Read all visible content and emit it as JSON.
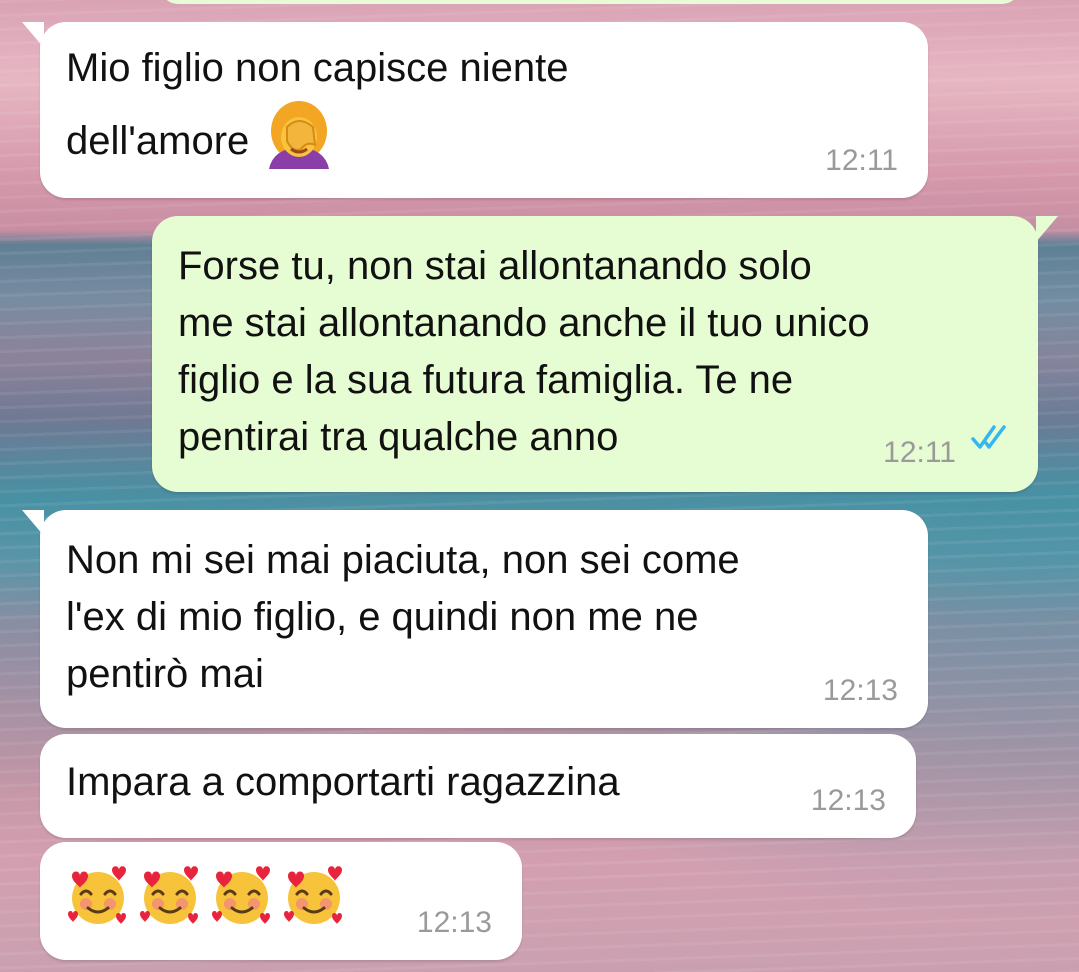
{
  "messages": [
    {
      "direction": "incoming",
      "lines": [
        "Mio figlio non capisce niente",
        "dell'amore"
      ],
      "emoji": "woman-facepalming",
      "time": "12:11"
    },
    {
      "direction": "outgoing",
      "lines": [
        "Forse tu, non stai allontanando solo",
        "me stai allontanando anche il tuo unico",
        "figlio e la sua futura famiglia. Te ne",
        "pentirai tra qualche anno"
      ],
      "time": "12:11",
      "status_icon": "double-check-read",
      "status_color": "#34b7f1"
    },
    {
      "direction": "incoming",
      "lines": [
        "Non mi sei mai piaciuta, non sei come",
        "l'ex di mio figlio, e quindi non me ne",
        "pentirò mai"
      ],
      "time": "12:13"
    },
    {
      "direction": "incoming",
      "lines": [
        "Impara a comportarti ragazzina"
      ],
      "time": "12:13"
    },
    {
      "direction": "incoming",
      "emoji_count": 4,
      "emoji": "smiling-face-with-hearts",
      "time": "12:13"
    }
  ],
  "colors": {
    "incoming_bubble": "#ffffff",
    "outgoing_bubble": "#e6fdd3",
    "timestamp": "#9a9a9a",
    "read_ticks": "#34b7f1"
  }
}
